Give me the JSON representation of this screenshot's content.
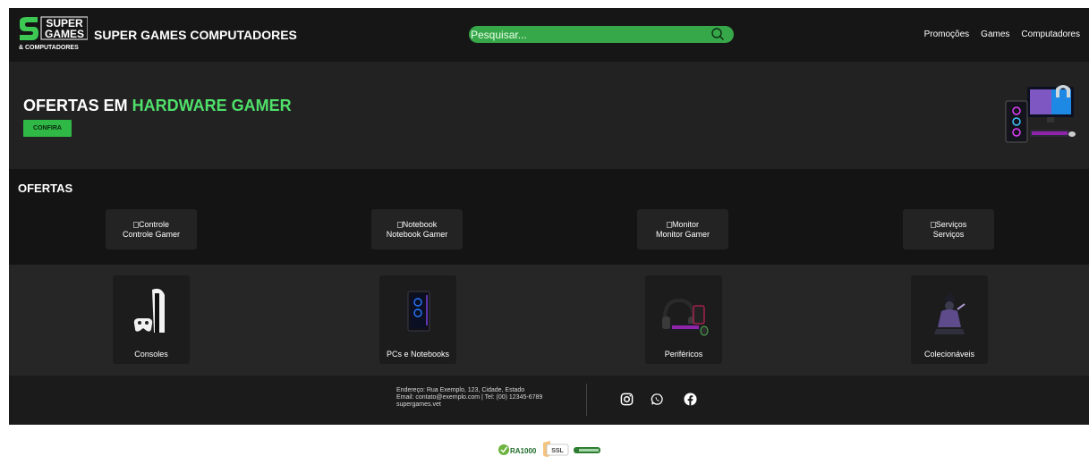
{
  "header": {
    "logo": {
      "line1": "SUPER",
      "line2": "GAMES",
      "line3": "& COMPUTADORES"
    },
    "brand": "SUPER GAMES COMPUTADORES",
    "search": {
      "placeholder": "Pesquisar...",
      "icon": "search-icon"
    },
    "nav": [
      "Promoções",
      "Games",
      "Computadores"
    ]
  },
  "banner": {
    "title_part1": "OFERTAS EM ",
    "title_highlight": "HARDWARE GAMER",
    "cta": "CONFIRA",
    "highlight_color": "#4fe06a"
  },
  "offers": {
    "title": "OFERTAS",
    "items": [
      {
        "alt": "Controle",
        "label": "Controle Gamer"
      },
      {
        "alt": "Notebook",
        "label": "Notebook Gamer"
      },
      {
        "alt": "Monitor",
        "label": "Monitor Gamer"
      },
      {
        "alt": "Serviços",
        "label": "Serviços"
      }
    ]
  },
  "categories": [
    {
      "label": "Consoles",
      "icon": "console-icon"
    },
    {
      "label": "PCs e Notebooks",
      "icon": "pc-case-icon"
    },
    {
      "label": "Periféricos",
      "icon": "peripherals-icon"
    },
    {
      "label": "Colecionáveis",
      "icon": "collectible-figure-icon"
    }
  ],
  "footer": {
    "address": "Endereço: Rua Exemplo, 123, Cidade, Estado",
    "contact": "Email: contato@exemplo.com | Tel: (00) 12345-6789",
    "site": "supergames.vet",
    "social": [
      "instagram-icon",
      "whatsapp-icon",
      "facebook-icon"
    ]
  },
  "badges": {
    "ra": "RA1000",
    "ssl": "SSL"
  },
  "colors": {
    "accent": "#37a84a",
    "header_bg": "#161616",
    "banner_bg": "#222222"
  }
}
